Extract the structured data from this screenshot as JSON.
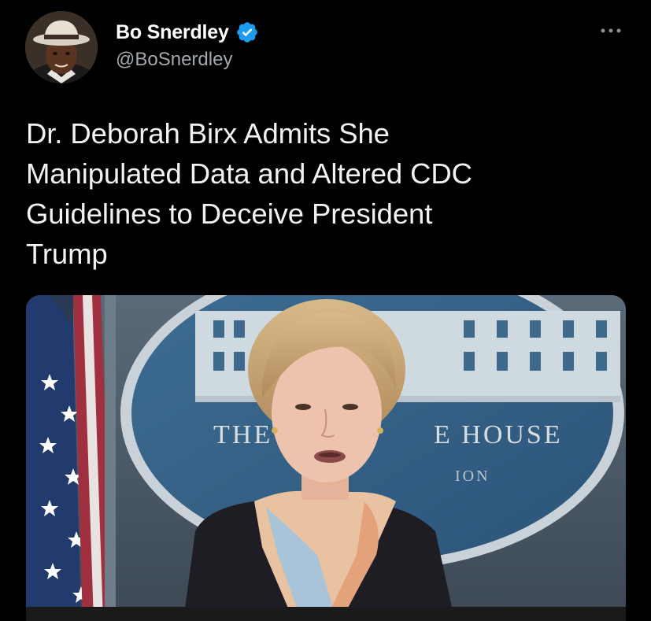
{
  "author": {
    "display_name": "Bo Snerdley",
    "handle": "@BoSnerdley",
    "verified": true,
    "verified_color": "#1d9bf0"
  },
  "menu": {
    "icon": "more-horizontal-icon"
  },
  "tweet": {
    "text": "Dr. Deborah Birx Admits She\nManipulated Data and Altered CDC\nGuidelines to Deceive President\nTrump"
  },
  "media": {
    "sign_text_left": "THE",
    "sign_text_right": "E HOUSE",
    "sign_text_lower": "ION"
  },
  "colors": {
    "background": "#000000",
    "text": "#f2f2f2",
    "secondary_text": "#a4a9ae"
  }
}
